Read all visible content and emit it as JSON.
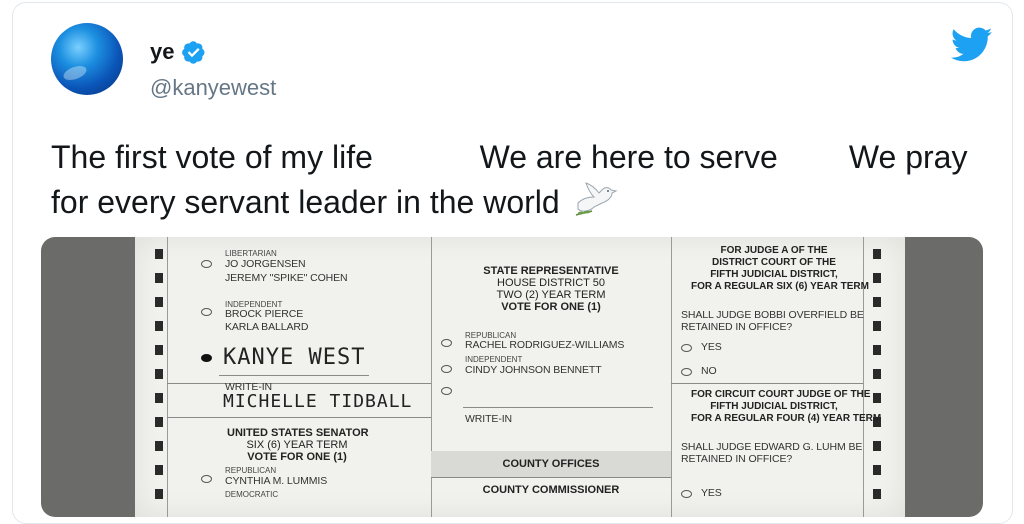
{
  "tweet": {
    "display_name": "ye",
    "handle": "@kanyewest",
    "text_segments": [
      "The first vote of my life",
      "We are here to serve",
      "We pray for every servant leader in the world"
    ],
    "icons": {
      "verified": "verified-badge-icon",
      "brand": "twitter-logo-icon",
      "emoji": "dove-icon"
    },
    "colors": {
      "brand": "#1da1f2",
      "handle": "#657786",
      "text": "#14171a"
    }
  },
  "ballot": {
    "col1": {
      "party1": "LIBERTARIAN",
      "cand1a": "JO JORGENSEN",
      "cand1b": "JEREMY \"SPIKE\" COHEN",
      "party2": "INDEPENDENT",
      "cand2a": "BROCK PIERCE",
      "cand2b": "KARLA BALLARD",
      "handwritten1": "KANYE WEST",
      "writein_label": "WRITE-IN",
      "handwritten2": "MICHELLE TIDBALL",
      "senate_h1": "UNITED STATES SENATOR",
      "senate_h2": "SIX (6) YEAR TERM",
      "senate_h3": "VOTE FOR ONE (1)",
      "party3": "REPUBLICAN",
      "cand3": "CYNTHIA M. LUMMIS",
      "party4": "DEMOCRATIC"
    },
    "col2": {
      "h1": "STATE REPRESENTATIVE",
      "h2": "HOUSE DISTRICT 50",
      "h3": "TWO (2) YEAR TERM",
      "h4": "VOTE FOR ONE (1)",
      "party1": "REPUBLICAN",
      "cand1": "RACHEL RODRIGUEZ-WILLIAMS",
      "party2": "INDEPENDENT",
      "cand2": "CINDY JOHNSON BENNETT",
      "writein_label": "WRITE-IN",
      "county_offices": "COUNTY OFFICES",
      "county_commissioner": "COUNTY COMMISSIONER"
    },
    "col3": {
      "j1_h1": "FOR JUDGE A OF THE",
      "j1_h2": "DISTRICT COURT OF THE",
      "j1_h3": "FIFTH JUDICIAL DISTRICT,",
      "j1_h4": "FOR A REGULAR SIX (6) YEAR TERM",
      "j1_q1": "SHALL JUDGE BOBBI OVERFIELD BE",
      "j1_q2": "RETAINED IN OFFICE?",
      "yes": "YES",
      "no": "NO",
      "j2_h1": "FOR CIRCUIT COURT JUDGE OF THE",
      "j2_h2": "FIFTH JUDICIAL DISTRICT,",
      "j2_h3": "FOR A REGULAR FOUR (4) YEAR TERM",
      "j2_q1": "SHALL JUDGE EDWARD G. LUHM BE",
      "j2_q2": "RETAINED IN OFFICE?",
      "yes2": "YES"
    }
  }
}
